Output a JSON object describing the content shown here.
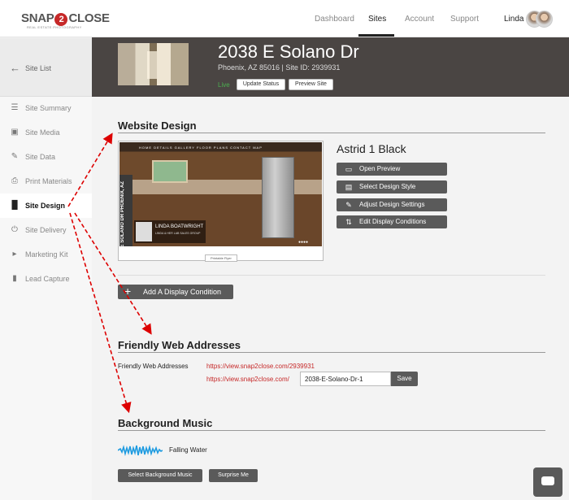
{
  "brand": {
    "logo_pre": "SNAP",
    "logo_mid": "2",
    "logo_post": "CLOSE",
    "logo_sub": "REAL ESTATE PHOTOGRAPHY"
  },
  "topnav": {
    "items": [
      "Dashboard",
      "Sites",
      "Account",
      "Support"
    ],
    "active": "Sites",
    "user_name": "Linda"
  },
  "sidebar": {
    "back_label": "Site List",
    "items": [
      {
        "label": "Site Summary",
        "icon": "list-icon"
      },
      {
        "label": "Site Media",
        "icon": "media-icon"
      },
      {
        "label": "Site Data",
        "icon": "pencil-icon"
      },
      {
        "label": "Print Materials",
        "icon": "printer-icon"
      },
      {
        "label": "Site Design",
        "icon": "brush-icon",
        "active": true
      },
      {
        "label": "Site Delivery",
        "icon": "power-icon"
      },
      {
        "label": "Marketing Kit",
        "icon": "megaphone-icon"
      },
      {
        "label": "Lead Capture",
        "icon": "phone-icon"
      }
    ]
  },
  "site": {
    "title": "2038 E Solano Dr",
    "subtitle": "Phoenix, AZ  85016 | Site ID: 2939931",
    "status": "Live",
    "update_status_label": "Update Status",
    "preview_site_label": "Preview Site"
  },
  "website_design": {
    "title": "Website Design",
    "design_name": "Astrid 1 Black",
    "buttons": [
      "Open Preview",
      "Select Design Style",
      "Adjust Design Settings",
      "Edit Display Conditions"
    ],
    "preview": {
      "nav": "HOME   DETAILS   GALLERY   FLOOR PLANS   CONTACT   MAP",
      "vertical_text": "2038 E SOLANO DR    PHOENIX, AZ",
      "agent_name": "LINDA BOATWRIGHT",
      "agent_company": "LINDA & HER LAB SALES GROUP",
      "flyer_label": "Printable Flyer"
    },
    "add_condition_label": "Add A Display Condition"
  },
  "friendly": {
    "title": "Friendly Web Addresses",
    "label": "Friendly Web Addresses",
    "url_full": "https://view.snap2close.com/2939931",
    "url_prefix": "https://view.snap2close.com/",
    "slug_value": "2038-E-Solano-Dr-1",
    "save_label": "Save"
  },
  "music": {
    "title": "Background Music",
    "track": "Falling Water",
    "select_label": "Select Background Music",
    "surprise_label": "Surprise Me"
  },
  "colors": {
    "accent": "#c62828",
    "header_bg": "#4a4543",
    "button_bg": "#5a5a5a",
    "live": "#4caf50"
  }
}
